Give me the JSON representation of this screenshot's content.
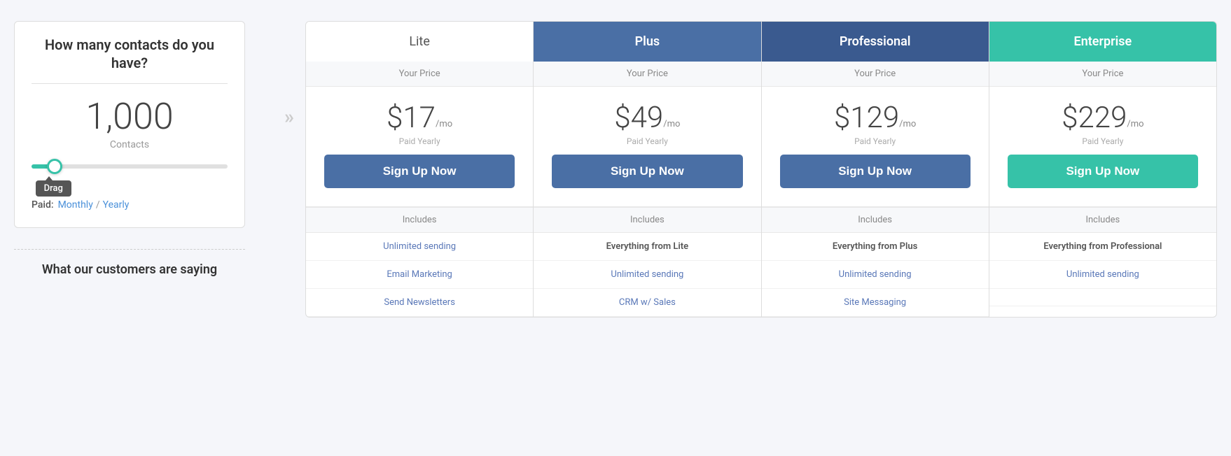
{
  "left": {
    "card_title": "How many contacts do you have?",
    "contacts_count": "1,000",
    "contacts_label": "Contacts",
    "drag_tooltip": "Drag",
    "billing_label": "Paid:",
    "billing_monthly": "Monthly",
    "billing_separator": "/",
    "billing_yearly": "Yearly",
    "customers_heading": "What our customers are saying"
  },
  "plans": [
    {
      "name": "Lite",
      "header_class": "lite",
      "your_price": "Your Price",
      "price": "$17",
      "period": "/mo",
      "paid_yearly": "Paid Yearly",
      "signup_label": "Sign Up Now",
      "btn_class": "blue",
      "includes_label": "Includes",
      "features": [
        "Unlimited sending",
        "Email Marketing",
        "Send Newsletters"
      ]
    },
    {
      "name": "Plus",
      "header_class": "plus",
      "your_price": "Your Price",
      "price": "$49",
      "period": "/mo",
      "paid_yearly": "Paid Yearly",
      "signup_label": "Sign Up Now",
      "btn_class": "blue",
      "includes_label": "Includes",
      "features": [
        "Everything from Lite",
        "Unlimited sending",
        "CRM w/ Sales"
      ]
    },
    {
      "name": "Professional",
      "header_class": "professional",
      "your_price": "Your Price",
      "price": "$129",
      "period": "/mo",
      "paid_yearly": "Paid Yearly",
      "signup_label": "Sign Up Now",
      "btn_class": "blue",
      "includes_label": "Includes",
      "features": [
        "Everything from Plus",
        "Unlimited sending",
        "Site Messaging"
      ]
    },
    {
      "name": "Enterprise",
      "header_class": "enterprise",
      "your_price": "Your Price",
      "price": "$229",
      "period": "/mo",
      "paid_yearly": "Paid Yearly",
      "signup_label": "Sign Up Now",
      "btn_class": "green",
      "includes_label": "Includes",
      "features": [
        "Everything from Professional",
        "Unlimited sending",
        ""
      ]
    }
  ]
}
